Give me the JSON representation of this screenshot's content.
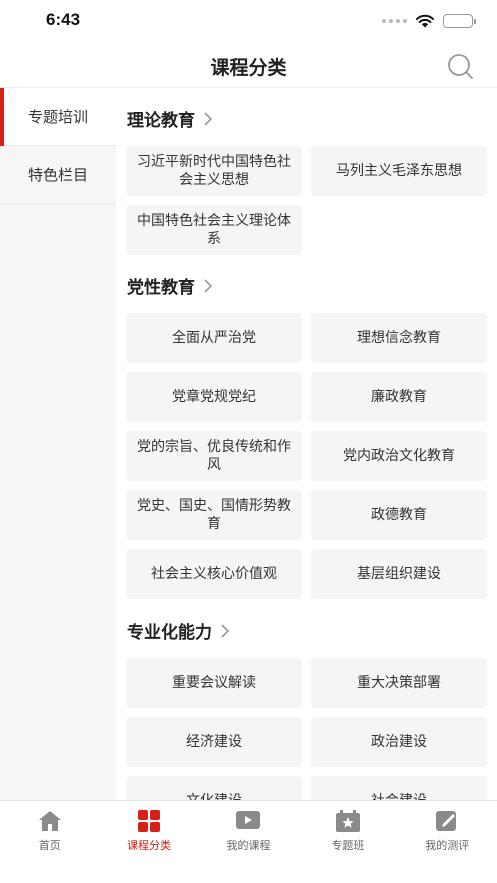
{
  "status": {
    "time": "6:43"
  },
  "header": {
    "title": "课程分类"
  },
  "sidebar": {
    "items": [
      {
        "label": "专题培训",
        "active": true
      },
      {
        "label": "特色栏目",
        "active": false
      }
    ]
  },
  "sections": [
    {
      "title": "理论教育",
      "cards": [
        "习近平新时代中国特色社会主义思想",
        "马列主义毛泽东思想",
        "中国特色社会主义理论体系"
      ]
    },
    {
      "title": "党性教育",
      "cards": [
        "全面从严治党",
        "理想信念教育",
        "党章党规党纪",
        "廉政教育",
        "党的宗旨、优良传统和作风",
        "党内政治文化教育",
        "党史、国史、国情形势教育",
        "政德教育",
        "社会主义核心价值观",
        "基层组织建设"
      ]
    },
    {
      "title": "专业化能力",
      "cards": [
        "重要会议解读",
        "重大决策部署",
        "经济建设",
        "政治建设",
        "文化建设",
        "社会建设"
      ]
    }
  ],
  "tabbar": {
    "items": [
      {
        "label": "首页",
        "icon": "home-icon"
      },
      {
        "label": "课程分类",
        "icon": "category-icon",
        "active": true
      },
      {
        "label": "我的课程",
        "icon": "play-icon"
      },
      {
        "label": "专题班",
        "icon": "star-board-icon"
      },
      {
        "label": "我的测评",
        "icon": "edit-icon"
      }
    ]
  },
  "colors": {
    "accent": "#d8201a",
    "card_bg": "#f5f5f5",
    "sidebar_bg": "#f6f6f6"
  }
}
